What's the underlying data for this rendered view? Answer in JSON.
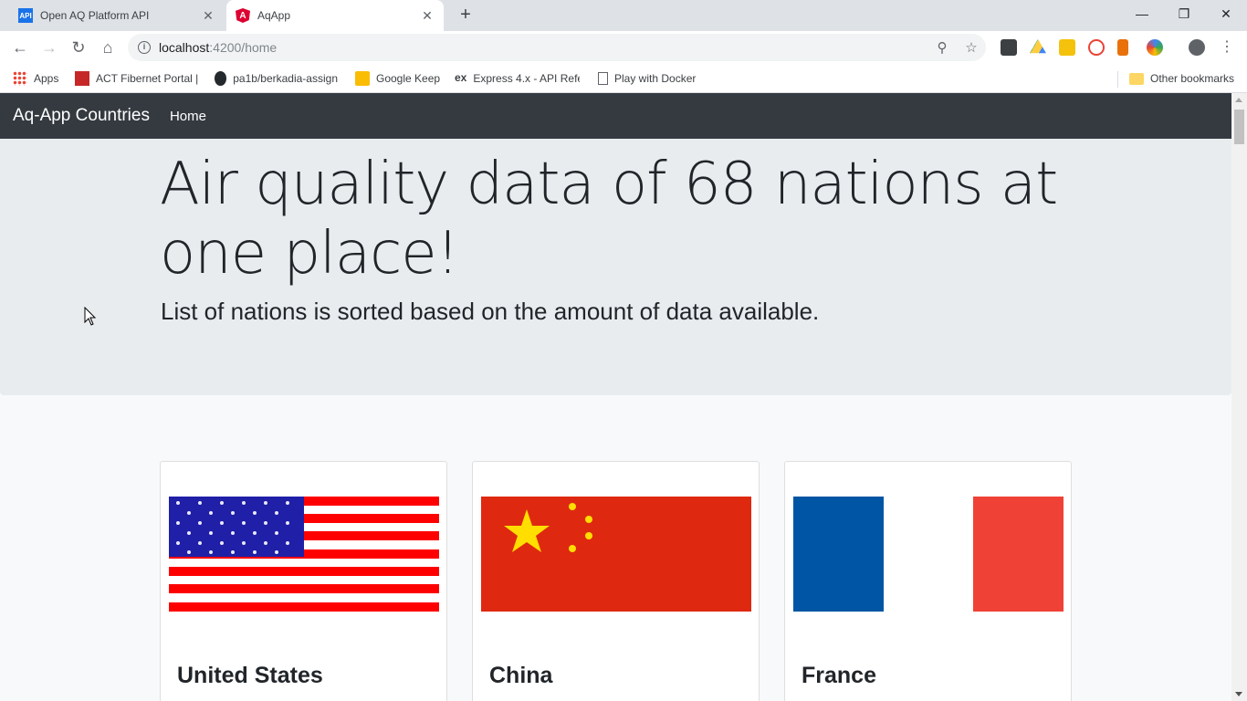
{
  "browser": {
    "tabs": [
      {
        "favicon": "API",
        "title": "Open AQ Platform API",
        "close": "✕"
      },
      {
        "favicon": "A",
        "title": "AqApp",
        "close": "✕"
      }
    ],
    "new_tab": "+",
    "window_controls": {
      "minimize": "—",
      "restore": "❐",
      "close": "✕"
    },
    "url_host": "localhost",
    "url_path": ":4200/home",
    "bookmarks": [
      {
        "label": "Apps"
      },
      {
        "label": "ACT Fibernet Portal |"
      },
      {
        "label": "pa1b/berkadia-assign"
      },
      {
        "label": "Google Keep"
      },
      {
        "label": "Express 4.x - API Refe"
      },
      {
        "label": "Play with Docker"
      }
    ],
    "other_bookmarks": "Other bookmarks"
  },
  "navbar": {
    "brand": "Aq-App Countries",
    "links": [
      "Home"
    ]
  },
  "hero": {
    "title": "Air quality data of 68 nations at one place!",
    "lead": "List of nations is sorted based on the amount of data available."
  },
  "countries": [
    {
      "name": "United States",
      "flag": "us-flag"
    },
    {
      "name": "China",
      "flag": "china-flag"
    },
    {
      "name": "France",
      "flag": "france-flag"
    }
  ],
  "colors": {
    "navbar_bg": "#343a40",
    "jumbotron_bg": "#e9ecef",
    "page_bg": "#f8f9fa"
  }
}
